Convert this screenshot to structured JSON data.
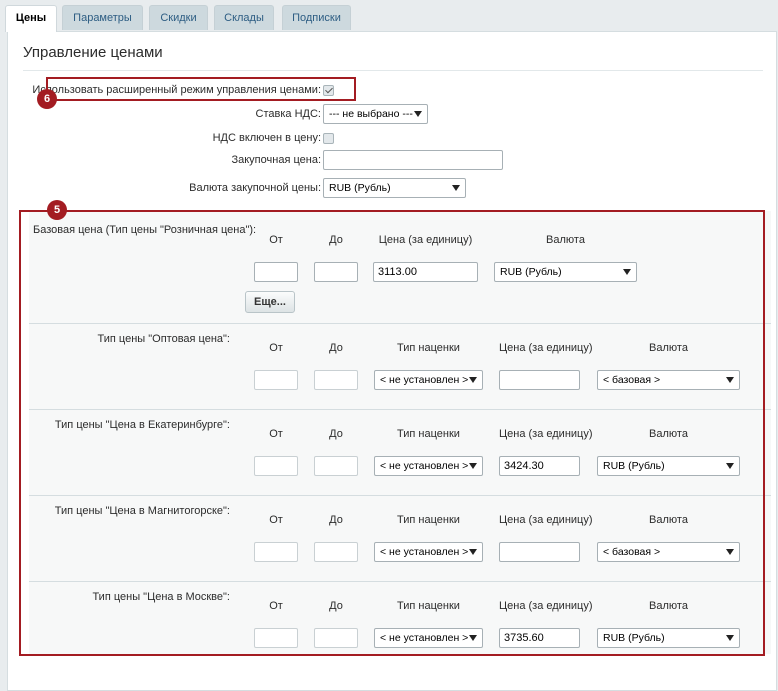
{
  "tabs": [
    {
      "label": "Цены",
      "active": true
    },
    {
      "label": "Параметры",
      "active": false
    },
    {
      "label": "Скидки",
      "active": false
    },
    {
      "label": "Склады",
      "active": false
    },
    {
      "label": "Подписки",
      "active": false
    }
  ],
  "section_title": "Управление ценами",
  "general": {
    "extended_mode_label": "Использовать расширенный режим управления ценами:",
    "extended_mode_checked": true,
    "vat_rate_label": "Ставка НДС:",
    "vat_rate_value": "--- не выбрано ---",
    "vat_included_label": "НДС включен в цену:",
    "vat_included_checked": false,
    "purchase_price_label": "Закупочная цена:",
    "purchase_price_value": "",
    "purchase_currency_label": "Валюта закупочной цены:",
    "purchase_currency_value": "RUB (Рубль)"
  },
  "annotations": {
    "badge_6": "6",
    "badge_5": "5"
  },
  "columns": {
    "from": "От",
    "to": "До",
    "markup_type": "Тип наценки",
    "price_per_unit": "Цена (за единицу)",
    "currency": "Валюта"
  },
  "base_price": {
    "label": "Базовая цена (Тип цены \"Розничная цена\"):",
    "from": "",
    "to": "",
    "price": "3113.00",
    "currency": "RUB (Рубль)",
    "more_button": "Еще..."
  },
  "price_types": [
    {
      "label": "Тип цены \"Оптовая цена\":",
      "markup": "< не установлен >",
      "price": "",
      "currency": "< базовая >"
    },
    {
      "label": "Тип цены \"Цена в Екатеринбурге\":",
      "markup": "< не установлен >",
      "price": "3424.30",
      "currency": "RUB (Рубль)"
    },
    {
      "label": "Тип цены \"Цена в Магнитогорске\":",
      "markup": "< не установлен >",
      "price": "",
      "currency": "< базовая >"
    },
    {
      "label": "Тип цены \"Цена в Москве\":",
      "markup": "< не установлен >",
      "price": "3735.60",
      "currency": "RUB (Рубль)"
    }
  ]
}
